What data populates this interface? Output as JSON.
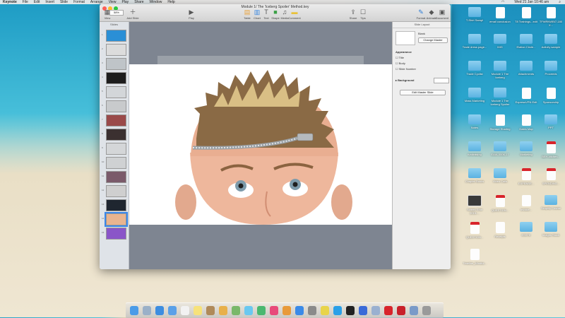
{
  "menubar": {
    "app": "Keynote",
    "items": [
      "File",
      "Edit",
      "Insert",
      "Slide",
      "Format",
      "Arrange",
      "View",
      "Play",
      "Share",
      "Window",
      "Help"
    ],
    "clock": "Wed 21 Jan  10:46 am"
  },
  "window": {
    "title": "Module 1/ The 'Iceberg Spoiler' Method.key",
    "zoom": "58%",
    "toolbar": {
      "view": "View",
      "zoom": "Zoom",
      "add_slide": "Add Slide",
      "play": "Play",
      "table": "Table",
      "chart": "Chart",
      "text": "Text",
      "shape": "Shape",
      "media": "Media",
      "comment": "Comment",
      "share": "Share",
      "tips": "Tips",
      "format": "Format",
      "animate": "Animate",
      "document": "Document"
    }
  },
  "slides_panel": {
    "header": "Slides",
    "numbers": [
      "1",
      "2",
      "3",
      "4",
      "5",
      "6",
      "7",
      "8",
      "9",
      "10",
      "11",
      "12",
      "13",
      "14",
      "15"
    ]
  },
  "inspector": {
    "header": "Slide Layout",
    "master_name": "Blank",
    "change_master": "Change Master",
    "appearance": "Appearance",
    "options": [
      "Title",
      "Body",
      "Slide Number"
    ],
    "background": "Background",
    "edit_master": "Edit Master Slide"
  },
  "desktop_icons": [
    {
      "label": "T-Shirt Sampl",
      "kind": "folder"
    },
    {
      "label": "email conclusion",
      "kind": "doc"
    },
    {
      "label": "T8 Trainings...edit",
      "kind": "doc"
    },
    {
      "label": "TFWRNWBI7-180 X...",
      "kind": "doc"
    },
    {
      "label": "Trade dress page...",
      "kind": "folder"
    },
    {
      "label": "IMG",
      "kind": "folder"
    },
    {
      "label": "Elation Circle...",
      "kind": "folder"
    },
    {
      "label": "Activity sample",
      "kind": "folder"
    },
    {
      "label": "Trade Cyclist",
      "kind": "folder"
    },
    {
      "label": "Module 1 The Iceberg",
      "kind": "folder"
    },
    {
      "label": "Attachments",
      "kind": "folder"
    },
    {
      "label": "Proceeds",
      "kind": "folder"
    },
    {
      "label": "Mass Marketing",
      "kind": "folder"
    },
    {
      "label": "Module 1 The Iceberg Spoiler",
      "kind": "folder"
    },
    {
      "label": "ExpressVPN Edit",
      "kind": "doc"
    },
    {
      "label": "Sponsorship",
      "kind": "doc"
    },
    {
      "label": "Notes",
      "kind": "folder"
    },
    {
      "label": "Storage Sharing",
      "kind": "doc"
    },
    {
      "label": "Dates Map",
      "kind": "doc"
    },
    {
      "label": "PPT",
      "kind": "folder"
    },
    {
      "label": "fundraising",
      "kind": "folder"
    },
    {
      "label": "EAIA-0006-17",
      "kind": "folder"
    },
    {
      "label": "Marketing",
      "kind": "folder"
    },
    {
      "label": "BEH-kitchen...",
      "kind": "pdf"
    },
    {
      "label": "Chapter Books",
      "kind": "folder"
    },
    {
      "label": "Video Calls",
      "kind": "folder"
    },
    {
      "label": "EXPENSE...",
      "kind": "pdf"
    },
    {
      "label": "SPENDING...",
      "kind": "pdf"
    },
    {
      "label": "Screen Shot 2015-...",
      "kind": "shot"
    },
    {
      "label": "QUESTION...",
      "kind": "pdf"
    },
    {
      "label": "Invoice...",
      "kind": "doc"
    },
    {
      "label": "Simplify Course",
      "kind": "folder"
    },
    {
      "label": "QUESTION...",
      "kind": "pdf"
    },
    {
      "label": "Receipts",
      "kind": "doc"
    },
    {
      "label": "ESSTE",
      "kind": "folder"
    },
    {
      "label": "Images Stock",
      "kind": "folder"
    },
    {
      "label": "Timeline_Mindful...",
      "kind": "doc"
    }
  ]
}
